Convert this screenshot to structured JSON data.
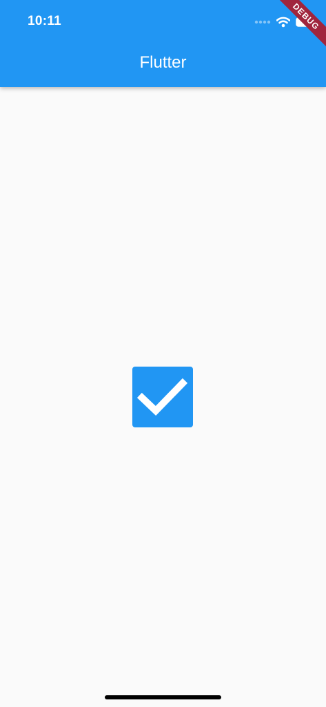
{
  "status_bar": {
    "time": "10:11",
    "icons": [
      "signal-icon",
      "wifi-icon",
      "battery-icon"
    ]
  },
  "app_bar": {
    "title": "Flutter",
    "color": "#2196f3"
  },
  "debug_banner": {
    "label": "DEBUG",
    "color": "#a0253d"
  },
  "checkbox": {
    "checked": true,
    "icon": "check-icon",
    "color": "#2196f3"
  },
  "colors": {
    "background": "#fafafa",
    "home_indicator": "#000000"
  }
}
